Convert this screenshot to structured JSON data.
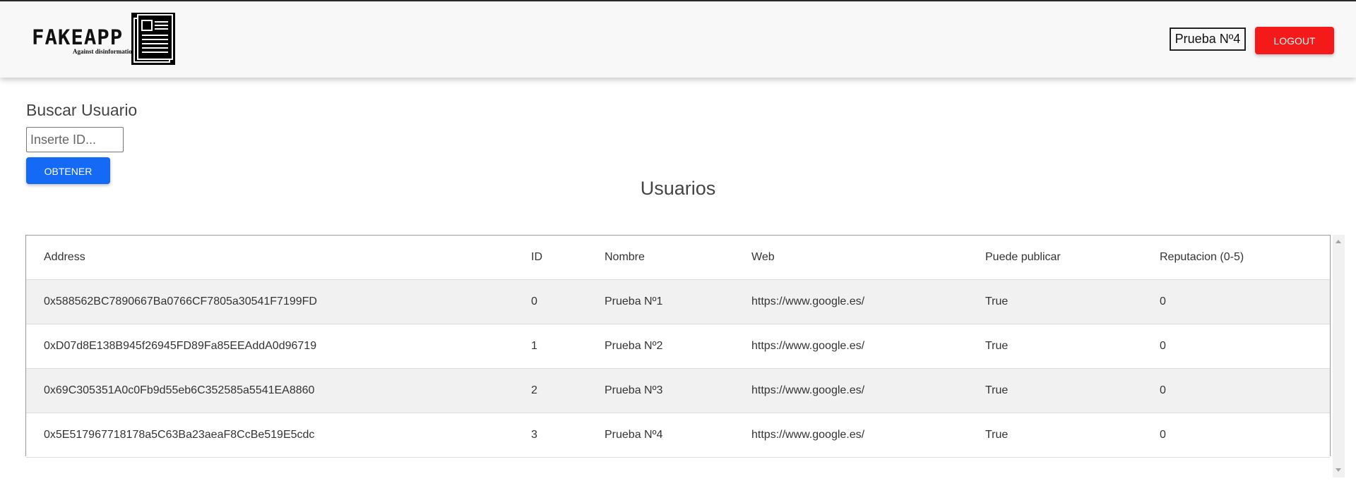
{
  "header": {
    "logo_text": "FAKEAPP",
    "logo_subtitle": "Against disinformation",
    "logo_icon": "newspaper-icon",
    "user_name": "Prueba Nº4",
    "logout_label": "LOGOUT",
    "logout_color": "#f41a1a"
  },
  "search": {
    "title": "Buscar Usuario",
    "placeholder": "Inserte ID...",
    "value": "",
    "button_label": "OBTENER",
    "button_color": "#1469f5"
  },
  "users": {
    "title": "Usuarios",
    "columns": [
      "Address",
      "ID",
      "Nombre",
      "Web",
      "Puede publicar",
      "Reputacion (0-5)"
    ],
    "rows": [
      [
        "0x588562BC7890667Ba0766CF7805a30541F7199FD",
        "0",
        "Prueba Nº1",
        "https://www.google.es/",
        "True",
        "0"
      ],
      [
        "0xD07d8E138B945f26945FD89Fa85EEAddA0d96719",
        "1",
        "Prueba Nº2",
        "https://www.google.es/",
        "True",
        "0"
      ],
      [
        "0x69C305351A0c0Fb9d55eb6C352585a5541EA8860",
        "2",
        "Prueba Nº3",
        "https://www.google.es/",
        "True",
        "0"
      ],
      [
        "0x5E517967718178a5C63Ba23aeaF8CcBe519E5cdc",
        "3",
        "Prueba Nº4",
        "https://www.google.es/",
        "True",
        "0"
      ]
    ]
  }
}
